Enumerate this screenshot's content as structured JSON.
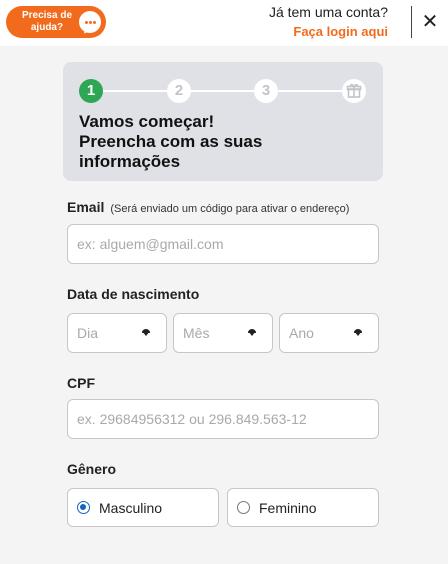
{
  "header": {
    "help_label": "Precisa de ajuda?",
    "account_question": "Já tem uma conta?",
    "login_link": "Faça login aqui",
    "close_glyph": "✕"
  },
  "stepper": {
    "steps": [
      "1",
      "2",
      "3"
    ],
    "final_icon": "gift-icon",
    "title_line1": "Vamos começar!",
    "title_line2": "Preencha com as suas",
    "title_line3": "informações"
  },
  "form": {
    "email": {
      "label": "Email",
      "hint": "(Será enviado um código para ativar o endereço)",
      "placeholder": "ex: alguem@gmail.com"
    },
    "birth": {
      "label": "Data de nascimento",
      "day": "Dia",
      "month": "Mês",
      "year": "Ano"
    },
    "cpf": {
      "label": "CPF",
      "placeholder": "ex. 29684956312 ou 296.849.563-12"
    },
    "gender": {
      "label": "Gênero",
      "options": [
        "Masculino",
        "Feminino"
      ],
      "selected": "Masculino"
    }
  },
  "colors": {
    "brand": "#f26b1d",
    "active_step": "#2fa653",
    "radio_selected": "#1565c0"
  }
}
